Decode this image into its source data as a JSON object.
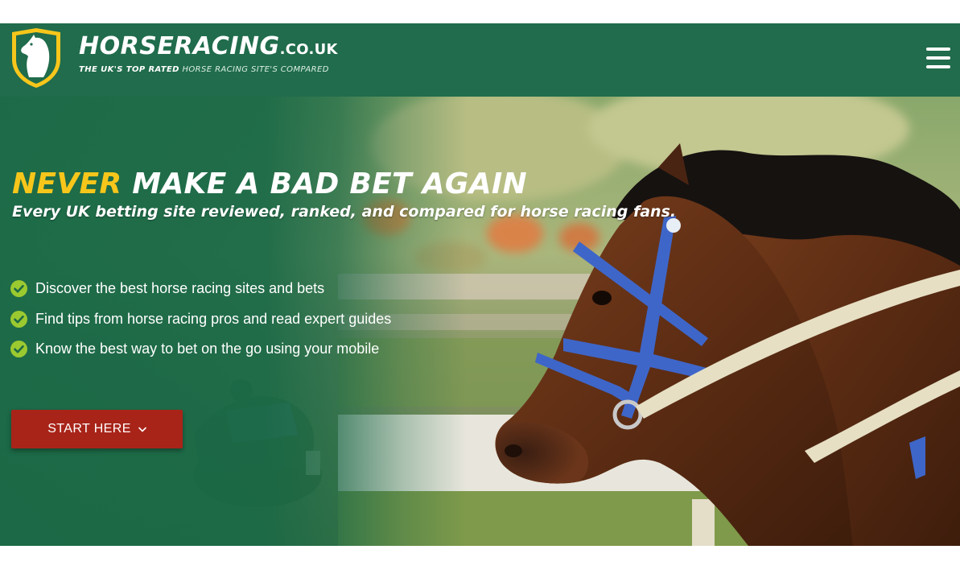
{
  "header": {
    "brand_name": "HORSERACING",
    "brand_tld": ".CO.UK",
    "tagline_strong": "THE UK'S TOP RATED",
    "tagline_rest": "HORSE RACING SITE'S COMPARED",
    "menu_icon": "hamburger-menu-icon",
    "logo_icon": "horse-head-shield-icon"
  },
  "hero": {
    "headline_accent": "NEVER",
    "headline_rest": "MAKE A BAD BET AGAIN",
    "subheadline": "Every UK betting site reviewed, ranked, and compared for horse racing fans.",
    "features": [
      {
        "icon": "check-circle-icon",
        "label": "Discover the best horse racing sites and bets"
      },
      {
        "icon": "check-circle-icon",
        "label": "Find tips from horse racing pros and read expert guides"
      },
      {
        "icon": "check-circle-icon",
        "label": "Know the best way to bet on the go using your mobile"
      }
    ],
    "cta_label": "START HERE",
    "cta_icon": "chevron-down-icon"
  },
  "colors": {
    "header_bg": "#206c4c",
    "accent_yellow": "#f7c61b",
    "check_green": "#9bc930",
    "cta_red": "#a82419",
    "text_white": "#ffffff"
  }
}
